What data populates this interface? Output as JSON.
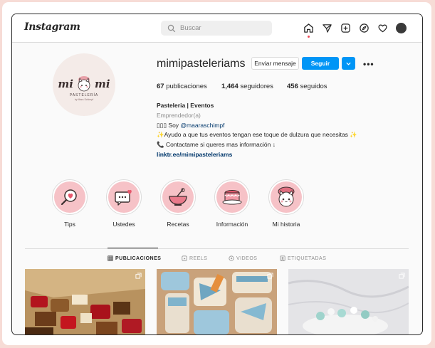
{
  "app": {
    "logo": "Instagram"
  },
  "search": {
    "placeholder": "Buscar"
  },
  "nav_icons": [
    "home-icon",
    "direct-icon",
    "new-post-icon",
    "explore-icon",
    "heart-icon",
    "profile-avatar"
  ],
  "profile": {
    "username": "mimipasteleriams",
    "avatar_text": {
      "left": "mi",
      "right": "mi",
      "line1": "PASTELERÍA",
      "line2": "by Mara Schimpf"
    },
    "buttons": {
      "message": "Enviar mensaje",
      "follow": "Seguir"
    },
    "stats": {
      "posts_count": "67",
      "posts_label": "publicaciones",
      "followers_count": "1,464",
      "followers_label": "seguidores",
      "following_count": "456",
      "following_label": "seguidos"
    },
    "bio": {
      "name": "Pasteleria | Eventos",
      "category": "Emprendedor(a)",
      "line1_prefix": "▯▯▯ Soy ",
      "line1_mention": "@maaraschimpf",
      "line2": "✨Ayudo a que tus eventos tengan ese toque de dulzura que necesitas ✨",
      "line3": "📞 Contactame si queres mas información ↓",
      "link": "linktr.ee/mimipasteleriams"
    }
  },
  "highlights": [
    {
      "label": "Tips",
      "icon": "magnifier-heart-icon"
    },
    {
      "label": "Ustedes",
      "icon": "chat-heart-icon"
    },
    {
      "label": "Recetas",
      "icon": "mixing-bowl-icon"
    },
    {
      "label": "Información",
      "icon": "cake-icon"
    },
    {
      "label": "Mi historia",
      "icon": "cat-chef-icon"
    }
  ],
  "tabs": [
    {
      "label": "PUBLICACIONES",
      "active": true
    },
    {
      "label": "REELS",
      "active": false
    },
    {
      "label": "VIDEOS",
      "active": false
    },
    {
      "label": "ETIQUETADAS",
      "active": false
    }
  ],
  "colors": {
    "accent": "#0095f6",
    "highlight_bg": "#f6c2c7",
    "frame_bg": "#f7dcd6"
  }
}
